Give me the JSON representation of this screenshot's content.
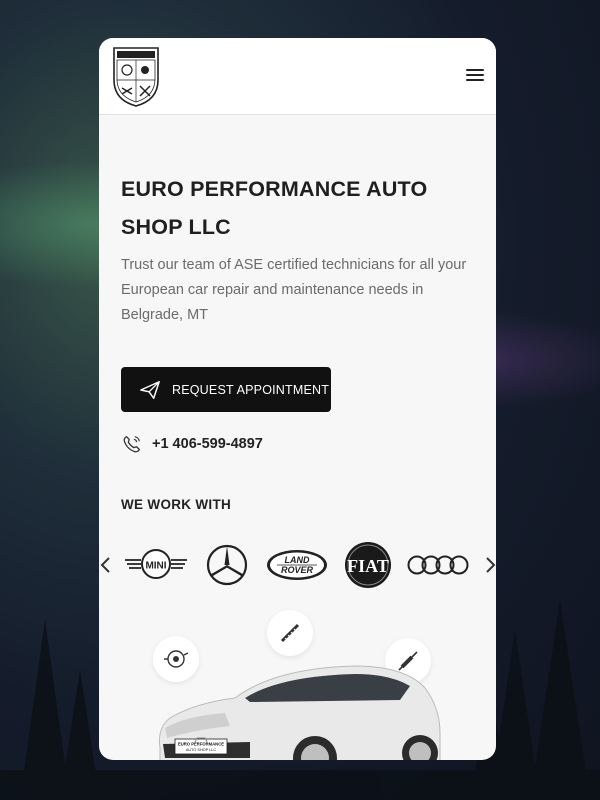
{
  "header": {
    "logo_text": "EUROPERFORMANCE",
    "menu_icon": "hamburger-menu-icon"
  },
  "hero": {
    "title_line1": "EURO PERFORMANCE AUTO",
    "title_line2": "SHOP LLC",
    "description": "Trust our team of ASE certified technicians for all your European car repair and maintenance needs in Belgrade, MT",
    "cta_label": "REQUEST APPOINTMENT",
    "phone": "+1 406-599-4897"
  },
  "brands_section": {
    "heading": "WE WORK WITH",
    "brands": [
      "MINI",
      "Mercedes-Benz",
      "LAND ROVER",
      "FIAT",
      "Audi"
    ],
    "brand_text": {
      "mini": "MINI",
      "land_top": "LAND",
      "land_bottom": "ROVER",
      "fiat": "FIAT"
    }
  },
  "car_plate": {
    "line1": "EURO PERFORMANCE",
    "line2": "AUTO SHOP LLC"
  },
  "colors": {
    "accent": "#111111",
    "text": "#1f1f1f",
    "muted": "#6b6b6b",
    "card_bg": "#f7f7f7"
  }
}
